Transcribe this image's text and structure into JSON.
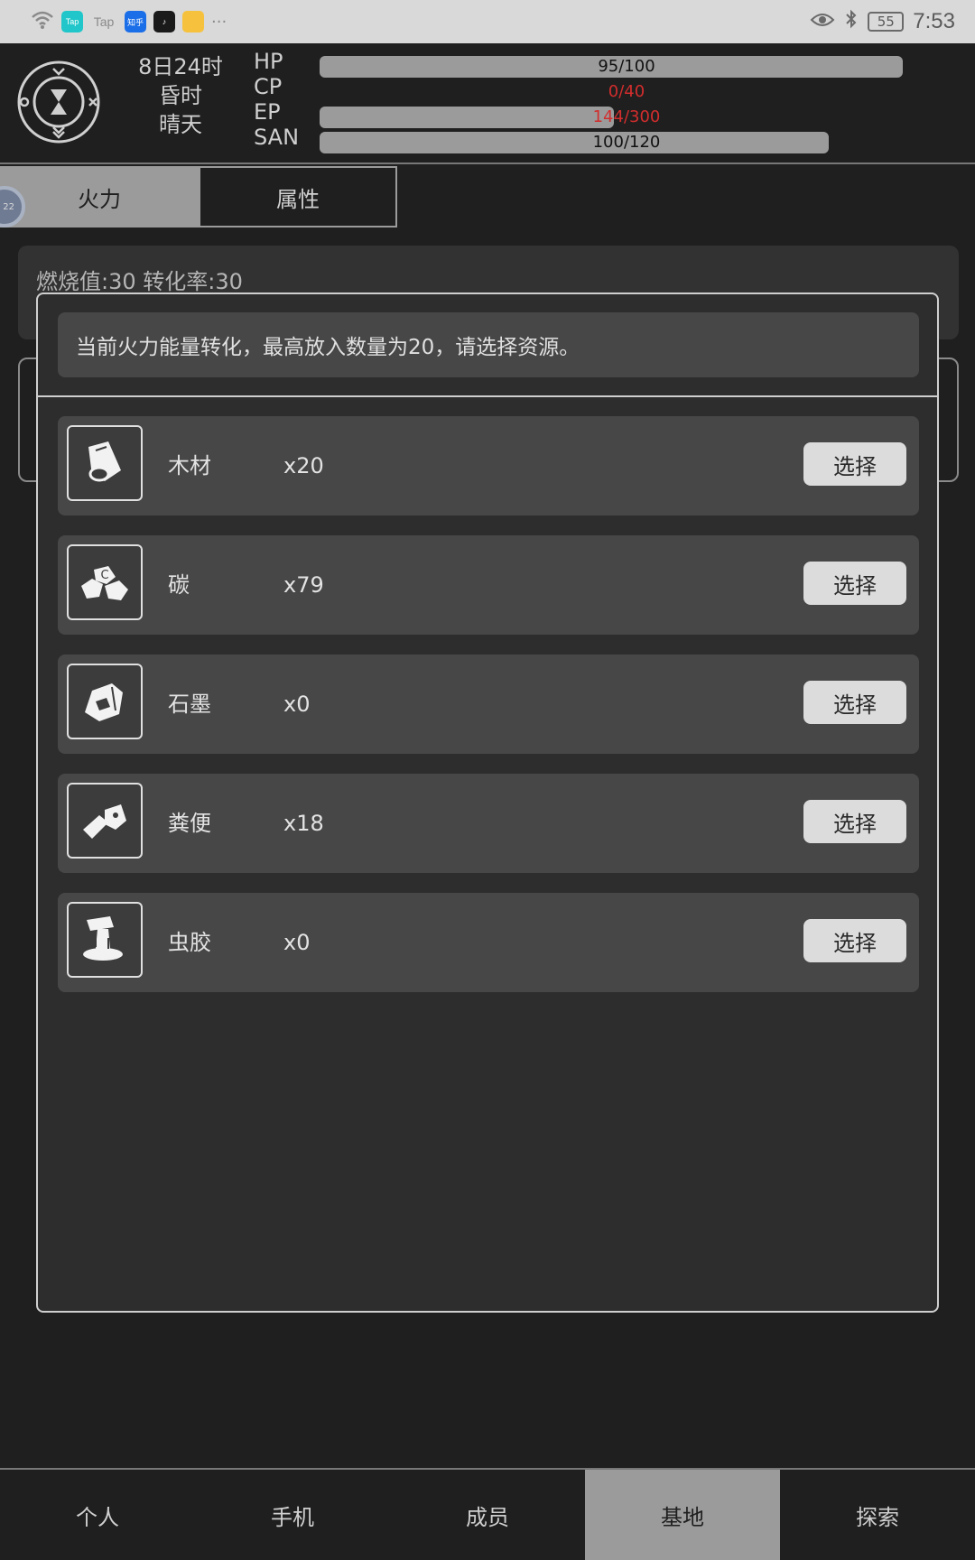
{
  "status_bar": {
    "icons": [
      "wifi-icon",
      "taptap-icon",
      "tap-icon",
      "zhihu-icon",
      "tiktok-icon",
      "gallery-icon",
      "more-icon"
    ],
    "app_labels": {
      "tap1": "Tap",
      "tap2": "Tap",
      "zhihu": "知乎",
      "tiktok": "♪"
    },
    "more": "···",
    "battery": "55",
    "time": "7:53"
  },
  "header": {
    "date": "8日24时",
    "period": "昏时",
    "weather": "晴天",
    "stats": [
      {
        "label": "HP",
        "text": "95/100",
        "fill": 0.95,
        "text_color": "#111111"
      },
      {
        "label": "CP",
        "text": "0/40",
        "fill": 0.0,
        "text_color": "#d22d2d"
      },
      {
        "label": "EP",
        "text": "144/300",
        "fill": 0.48,
        "text_color": "#d22d2d"
      },
      {
        "label": "SAN",
        "text": "100/120",
        "fill": 0.83,
        "text_color": "#111111"
      }
    ]
  },
  "tabs": [
    {
      "label": "火力",
      "active": true
    },
    {
      "label": "属性",
      "active": false
    }
  ],
  "side_badge": "22",
  "panel": {
    "info": "燃烧值:30 转化率:30"
  },
  "modal": {
    "message": "当前火力能量转化，最高放入数量为20，请选择资源。",
    "items": [
      {
        "icon": "wood-icon",
        "name": "木材",
        "qty": "x20",
        "button": "选择"
      },
      {
        "icon": "carbon-icon",
        "name": "碳",
        "qty": "x79",
        "button": "选择"
      },
      {
        "icon": "graphite-icon",
        "name": "石墨",
        "qty": "x0",
        "button": "选择"
      },
      {
        "icon": "manure-icon",
        "name": "粪便",
        "qty": "x18",
        "button": "选择"
      },
      {
        "icon": "resin-icon",
        "name": "虫胶",
        "qty": "x0",
        "button": "选择"
      }
    ]
  },
  "bottom_nav": [
    {
      "label": "个人",
      "active": false
    },
    {
      "label": "手机",
      "active": false
    },
    {
      "label": "成员",
      "active": false
    },
    {
      "label": "基地",
      "active": true
    },
    {
      "label": "探索",
      "active": false
    }
  ],
  "colors": {
    "background": "#1f1f1f",
    "bar_fill": "#9b9b9b",
    "warning_text": "#d22d2d",
    "button": "#dcdcdc"
  }
}
